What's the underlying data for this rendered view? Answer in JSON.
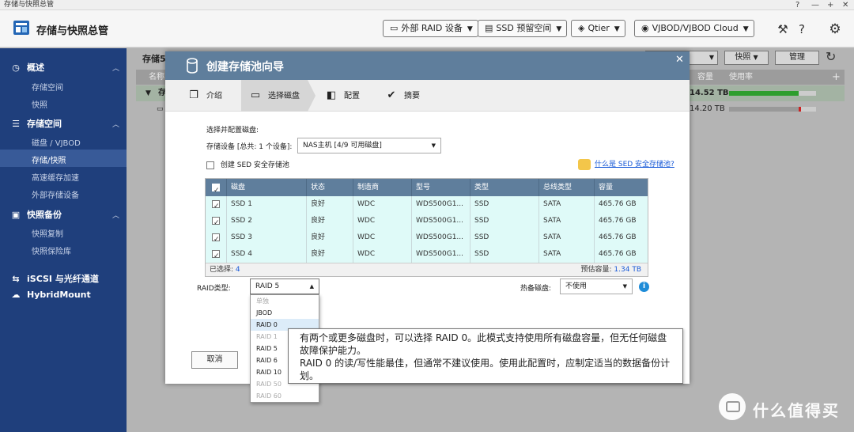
{
  "window": {
    "title": "存储与快照总管",
    "controls": [
      "?",
      "—",
      "+",
      "✕"
    ]
  },
  "app": {
    "title": "存储与快照总管",
    "buttons": {
      "external_raid": "外部 RAID 设备",
      "ssd_reserved": "SSD 预留空间",
      "qtier": "Qtier",
      "vjbod": "VJBOD/VJBOD Cloud"
    }
  },
  "sidebar": {
    "overview": "概述",
    "overview_items": [
      "存储空间",
      "快照"
    ],
    "storage": "存储空间",
    "storage_items": [
      "磁盘 / VJBOD",
      "存储/快照",
      "高速缓存加速",
      "外部存储设备"
    ],
    "backup": "快照备份",
    "backup_items": [
      "快照复制",
      "快照保险库"
    ],
    "iscsi": "iSCSI 与光纤通道",
    "hybridmount": "HybridMount"
  },
  "background": {
    "page_title": "存储5",
    "buttons": {
      "snapshot": "快照",
      "manage": "管理"
    },
    "table": {
      "name_col": "名称",
      "capacity_col": "容量",
      "usage_col": "使用率"
    },
    "rows": [
      {
        "name": "存",
        "capacity": "14.52 TB",
        "usage": 0.8
      },
      {
        "name": "",
        "capacity": "14.20 TB",
        "usage": 0.8
      }
    ]
  },
  "dialog": {
    "title": "创建存储池向导",
    "close": "✕",
    "steps": [
      "介绍",
      "选择磁盘",
      "配置",
      "摘要"
    ],
    "section_title": "选择并配置磁盘:",
    "device_label": "存储设备 [总共: 1 个设备]:",
    "device_value": "NAS主机 [4/9 可用磁盘]",
    "sed_checkbox": "创建 SED 安全存储池",
    "sed_link": "什么是 SED 安全存储池?",
    "table": {
      "columns": [
        "磁盘",
        "状态",
        "制造商",
        "型号",
        "类型",
        "总线类型",
        "容量"
      ],
      "rows": [
        [
          "SSD 1",
          "良好",
          "WDC",
          "WDS500G1...",
          "SSD",
          "SATA",
          "465.76 GB"
        ],
        [
          "SSD 2",
          "良好",
          "WDC",
          "WDS500G1...",
          "SSD",
          "SATA",
          "465.76 GB"
        ],
        [
          "SSD 3",
          "良好",
          "WDC",
          "WDS500G1...",
          "SSD",
          "SATA",
          "465.76 GB"
        ],
        [
          "SSD 4",
          "良好",
          "WDC",
          "WDS500G1...",
          "SSD",
          "SATA",
          "465.76 GB"
        ]
      ],
      "selected_label": "已选择:",
      "selected_count": "4",
      "estimated_label": "预估容量:",
      "estimated_value": "1.34 TB"
    },
    "raid_label": "RAID类型:",
    "raid_value": "RAID 5",
    "hotspare_label": "热备磁盘:",
    "hotspare_value": "不使用",
    "cancel": "取消"
  },
  "raid_dropdown": {
    "options": [
      {
        "label": "单独",
        "disabled": true
      },
      {
        "label": "JBOD",
        "disabled": false
      },
      {
        "label": "RAID 0",
        "disabled": false,
        "highlighted": true
      },
      {
        "label": "RAID 1",
        "disabled": true
      },
      {
        "label": "RAID 5",
        "disabled": false
      },
      {
        "label": "RAID 6",
        "disabled": false
      },
      {
        "label": "RAID 10",
        "disabled": false
      },
      {
        "label": "RAID 50",
        "disabled": true
      },
      {
        "label": "RAID 60",
        "disabled": true
      }
    ]
  },
  "tooltip": {
    "line1": "有两个或更多磁盘时，可以选择 RAID 0。此模式支持使用所有磁盘容量，但无任何磁盘故障保护能力。",
    "line2": "RAID 0 的读/写性能最佳，但通常不建议使用。使用此配置时，应制定适当的数据备份计划。"
  },
  "watermark": {
    "text": "什么值得买"
  },
  "colors": {
    "sidebar": "#1f3f7c",
    "dialog_header": "#5f7e9c",
    "disk_row": "#dffaf8",
    "link": "#1a5bd8",
    "usage_bar": "#2e9e2e"
  }
}
